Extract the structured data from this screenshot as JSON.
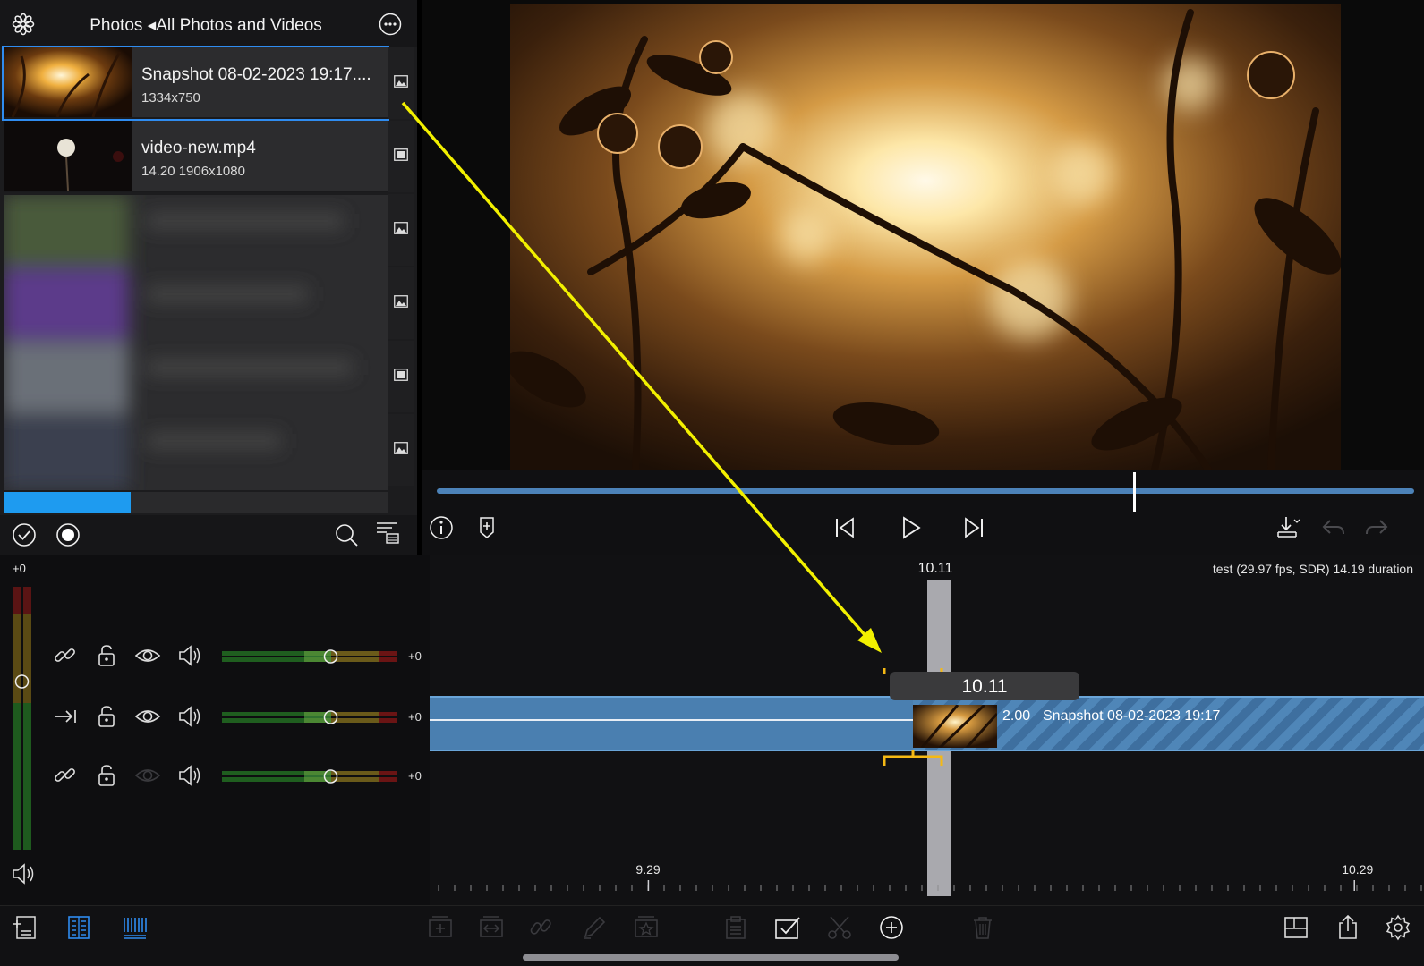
{
  "browser": {
    "title": "Photos ◂All Photos and Videos",
    "items": [
      {
        "title": "Snapshot 08-02-2023 19:17....",
        "subtitle": "1334x750",
        "type_icon": "photo-icon"
      },
      {
        "title": "video-new.mp4",
        "subtitle": "14.20  1906x1080",
        "type_icon": "film-icon"
      }
    ],
    "blurred_type_icons": [
      "photo-icon",
      "photo-icon",
      "film-icon",
      "photo-icon"
    ],
    "progress_fraction": 0.33
  },
  "viewer": {
    "playhead_fraction": 0.712
  },
  "tracks": {
    "master_gain": "+0",
    "rows": [
      {
        "link_icon": "link-icon",
        "gain": "+0",
        "fader_fraction": 0.62
      },
      {
        "link_icon": "connect-arrow-icon",
        "gain": "+0",
        "fader_fraction": 0.62
      },
      {
        "link_icon": "link-icon",
        "gain": "+0",
        "fader_fraction": 0.62
      }
    ]
  },
  "timeline": {
    "project_info": "test (29.97 fps, SDR)  14.19 duration",
    "playhead_time": "10.11",
    "tooltip_time": "10.11",
    "photo_clip": {
      "duration": "2.00",
      "name": "Snapshot 08-02-2023 19:17"
    },
    "ruler_labels": [
      {
        "text": "9.29",
        "pos": 0.22
      },
      {
        "text": "10.29",
        "pos": 0.93
      }
    ]
  },
  "colors": {
    "accent_blue": "#2f8cf0",
    "clip_blue": "#4a7fb0",
    "annotation_arrow": "#f2f000",
    "playhead_gray": "#a9a9ae"
  }
}
